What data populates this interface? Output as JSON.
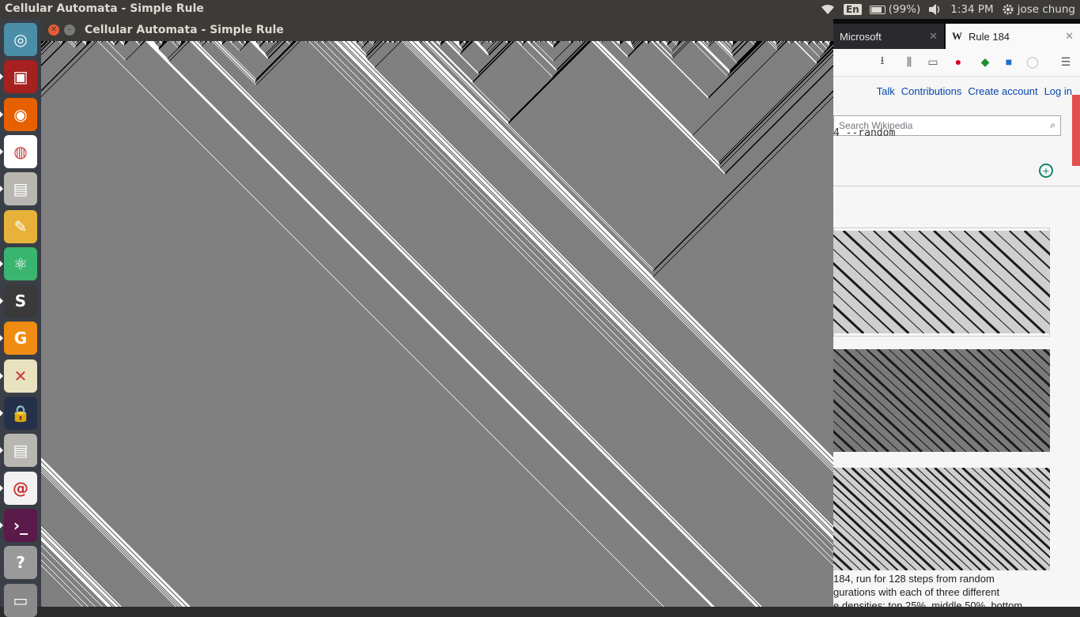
{
  "top_panel": {
    "active_app_title": "Cellular Automata - Simple Rule",
    "keyboard_layout": "En",
    "battery_text": "(99%)",
    "time": "1:34 PM",
    "user": "jose chung"
  },
  "launcher": {
    "items": [
      {
        "name": "ubuntu-dash",
        "icon": "ubuntu-logo-icon",
        "bg": "#4a8ea7"
      },
      {
        "name": "system-monitor",
        "icon": "monitor-icon",
        "bg": "#a62020"
      },
      {
        "name": "firefox",
        "icon": "firefox-icon",
        "bg": "#e66000"
      },
      {
        "name": "chrome",
        "icon": "chrome-icon",
        "bg": "#ffffff"
      },
      {
        "name": "files",
        "icon": "file-cabinet-icon",
        "bg": "#b8b6b0"
      },
      {
        "name": "settings-tools",
        "icon": "tools-icon",
        "bg": "#e8b23a"
      },
      {
        "name": "atom",
        "icon": "atom-icon",
        "bg": "#39b56f"
      },
      {
        "name": "sublime-text",
        "icon": "sublime-icon",
        "bg": "#3a3a3a"
      },
      {
        "name": "pdf-tool",
        "icon": "pdf-icon",
        "bg": "#ef8c12"
      },
      {
        "name": "xampp",
        "icon": "x-logo-icon",
        "bg": "#e8e2c0"
      },
      {
        "name": "lock",
        "icon": "lock-icon",
        "bg": "#25304a"
      },
      {
        "name": "files-2",
        "icon": "file-cabinet-icon",
        "bg": "#b8b6b0"
      },
      {
        "name": "debian-tool",
        "icon": "swirl-icon",
        "bg": "#f2f2f2"
      },
      {
        "name": "terminal",
        "icon": "terminal-icon",
        "bg": "#5a1a4a"
      },
      {
        "name": "help",
        "icon": "question-icon",
        "bg": "#9a9a9a"
      },
      {
        "name": "trash",
        "icon": "trash-icon",
        "bg": "#8a8a8a"
      }
    ],
    "running_indicator_rows": [
      1,
      2,
      3,
      4,
      6,
      7,
      8,
      9,
      10,
      11,
      12,
      13
    ]
  },
  "ca_window": {
    "title": "Cellular Automata - Simple Rule",
    "rule": 184
  },
  "browser": {
    "tab_inactive": "Microsoft",
    "tab_active": "Rule 184",
    "links": [
      "Talk",
      "Contributions",
      "Create account",
      "Log in"
    ],
    "search_placeholder": "Search Wikipedia",
    "terminal_overlay": "4 --random",
    "caption_lines": [
      "184, run for 128 steps from random",
      "gurations with each of three different",
      "e densities: top 25%, middle 50%, bottom"
    ]
  }
}
